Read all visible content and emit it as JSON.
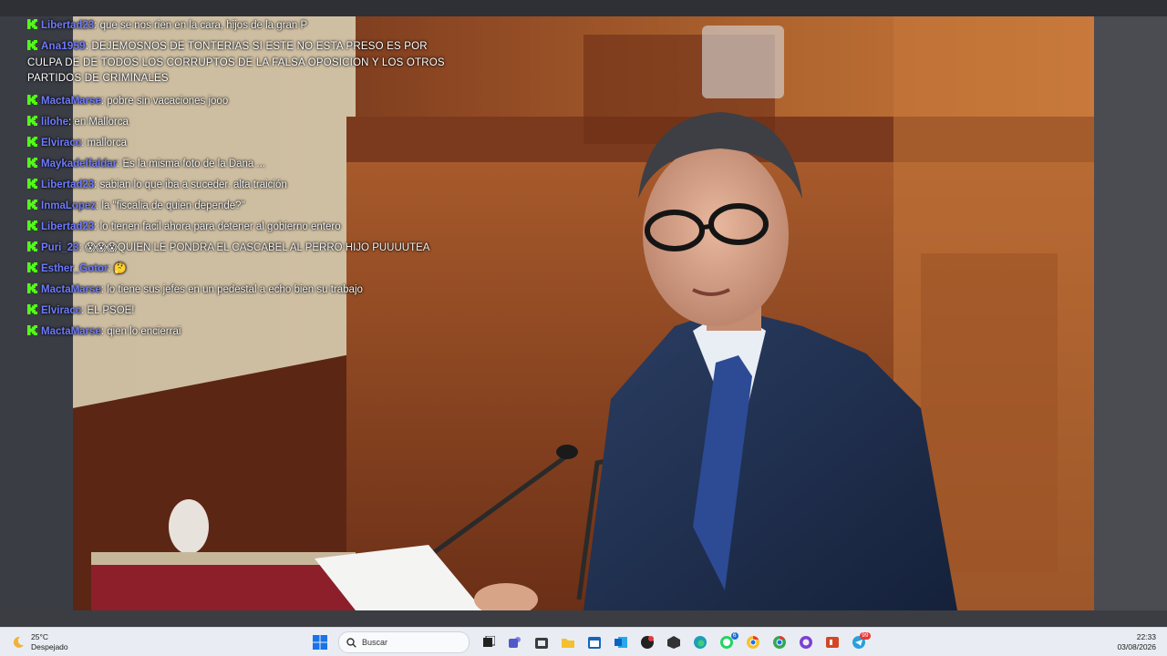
{
  "chat": {
    "messages": [
      {
        "user": "Libertad23",
        "text": "que se nos rien en la cara, hijos de la gran P"
      },
      {
        "user": "Ana1959",
        "text": "DEJEMOSNOS DE TONTERIAS SI ESTE NO ESTA PRESO ES POR CULPA DE DE TODOS LOS CORRUPTOS DE LA FALSA OPOSICION Y LOS OTROS PARTIDOS DE CRIMINALES",
        "long": true
      },
      {
        "user": "MactaMarse",
        "text": "pobre sin vacaciones jooo"
      },
      {
        "user": "lilohe",
        "text": "en Mallorca"
      },
      {
        "user": "Elviracc",
        "text": "mallorca"
      },
      {
        "user": "Maykadelfaldar",
        "text": "Es la misma foto de la Dana ..."
      },
      {
        "user": "Libertad23",
        "text": "sabian lo que iba a suceder. alta traición"
      },
      {
        "user": "InmaLopez",
        "text": "la \"fiscalia de quien depende?\""
      },
      {
        "user": "Libertad23",
        "text": "lo tienen facil ahora para detener al gobierno entero"
      },
      {
        "user": "Puri_23",
        "text": "😱😱😱QUIEN LE PONDRA EL CASCABEL AL PERRO HIJO PUUUUTEA"
      },
      {
        "user": "Esther_Gotor",
        "text": "🤔"
      },
      {
        "user": "MactaMarse",
        "text": "lo tiene sus jefes en un pedestal a echo bien su trabajo"
      },
      {
        "user": "Elviracc",
        "text": "EL PSOE!"
      },
      {
        "user": "MactaMarse",
        "text": "qien lo encierrai"
      }
    ],
    "badge_color": "#53fc18",
    "username_color": "#6f7bff"
  },
  "taskbar": {
    "weather": {
      "temp": "25°C",
      "condition": "Despejado",
      "icon": "moon-icon"
    },
    "search_placeholder": "Buscar",
    "icons": [
      {
        "name": "start-icon"
      },
      {
        "name": "task-view-icon"
      },
      {
        "name": "teams-icon"
      },
      {
        "name": "store-icon"
      },
      {
        "name": "file-explorer-icon"
      },
      {
        "name": "calendar-icon"
      },
      {
        "name": "outlook-icon"
      },
      {
        "name": "app-dark-icon"
      },
      {
        "name": "app-cube-icon"
      },
      {
        "name": "edge-icon"
      },
      {
        "name": "whatsapp-icon",
        "badge": "6"
      },
      {
        "name": "chrome-icon",
        "badge": ""
      },
      {
        "name": "chrome-alt-icon"
      },
      {
        "name": "app-circle-icon"
      },
      {
        "name": "powerpoint-icon"
      },
      {
        "name": "telegram-icon",
        "badge": "99"
      }
    ],
    "time": "22:33",
    "date": "03/08/2026"
  }
}
